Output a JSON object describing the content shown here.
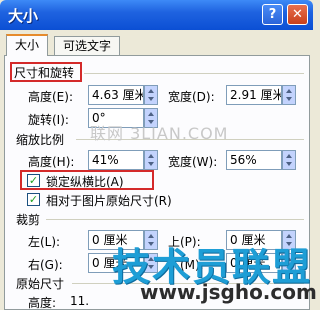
{
  "window": {
    "title": "大小",
    "help_label": "?",
    "close_label": "✕"
  },
  "tabs": [
    {
      "label": "大小",
      "active": true
    },
    {
      "label": "可选文字",
      "active": false
    }
  ],
  "sections": {
    "size_rotate": "尺寸和旋转",
    "scale": "缩放比例",
    "crop": "裁剪",
    "original": "原始尺寸"
  },
  "size_rotate": {
    "height_label": "高度(E):",
    "height_value": "4.63 厘米",
    "width_label": "宽度(D):",
    "width_value": "2.91 厘米",
    "rotate_label": "旋转(I):",
    "rotate_value": "0°"
  },
  "scale": {
    "height_label": "高度(H):",
    "height_value": "41%",
    "width_label": "宽度(W):",
    "width_value": "56%",
    "lock_ratio_label": "锁定纵横比(A)",
    "lock_ratio_checked": true,
    "relative_label": "相对于图片原始尺寸(R)",
    "relative_checked": true
  },
  "crop": {
    "left_label": "左(L):",
    "left_value": "0 厘米",
    "top_label": "上(P):",
    "top_value": "0 厘米",
    "right_label": "右(G):",
    "right_value": "0 厘米",
    "bottom_label": "下(M):",
    "bottom_value": "0 厘米"
  },
  "original": {
    "height_label": "高度:",
    "height_value": "11."
  },
  "watermarks": {
    "top": "联网 3LIAN.COM",
    "brand": "技术员联盟",
    "url": "www.jsgho.com"
  },
  "colors": {
    "titlebar": "#0b4fd4",
    "highlight": "#d42a2a",
    "accent_tab": "#e68b2c"
  }
}
